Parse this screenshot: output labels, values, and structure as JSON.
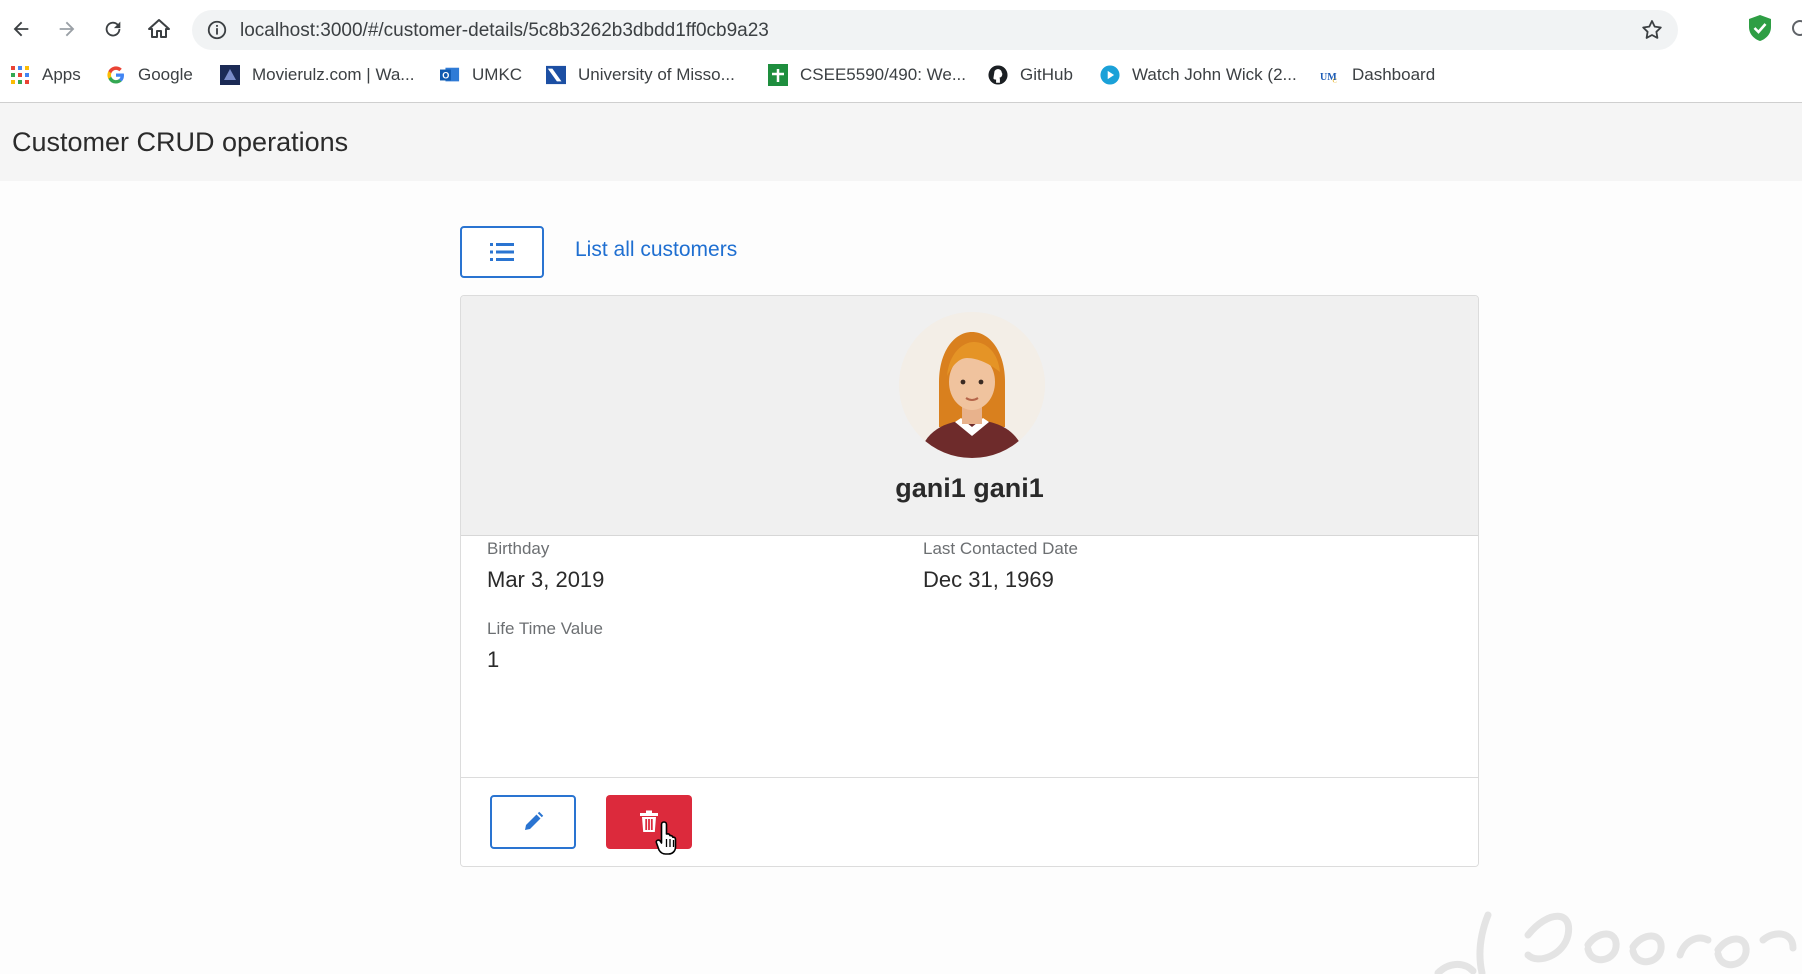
{
  "browser": {
    "url": "localhost:3000/#/customer-details/5c8b3262b3dbdd1ff0cb9a23",
    "bookmarks": [
      {
        "label": "Apps",
        "icon": "apps-grid-icon"
      },
      {
        "label": "Google",
        "icon": "google-icon"
      },
      {
        "label": "Movierulz.com | Wa...",
        "icon": "movierulz-icon"
      },
      {
        "label": "UMKC",
        "icon": "outlook-icon"
      },
      {
        "label": "University of Misso...",
        "icon": "university-icon"
      },
      {
        "label": "CSEE5590/490: We...",
        "icon": "sheets-icon"
      },
      {
        "label": "GitHub",
        "icon": "github-icon"
      },
      {
        "label": "Watch John Wick (2...",
        "icon": "play-icon"
      },
      {
        "label": "Dashboard",
        "icon": "umkc-dashboard-icon"
      }
    ]
  },
  "app": {
    "title": "Customer CRUD operations"
  },
  "nav": {
    "list_link": "List all customers"
  },
  "customer": {
    "name": "gani1 gani1",
    "fields": {
      "birthday_label": "Birthday",
      "birthday_value": "Mar 3, 2019",
      "last_contacted_label": "Last Contacted Date",
      "last_contacted_value": "Dec 31, 1969",
      "ltv_label": "Life Time Value",
      "ltv_value": "1"
    }
  },
  "colors": {
    "primary": "#2a74d1",
    "danger": "#dc2a3c",
    "link": "#1f6fd1"
  }
}
